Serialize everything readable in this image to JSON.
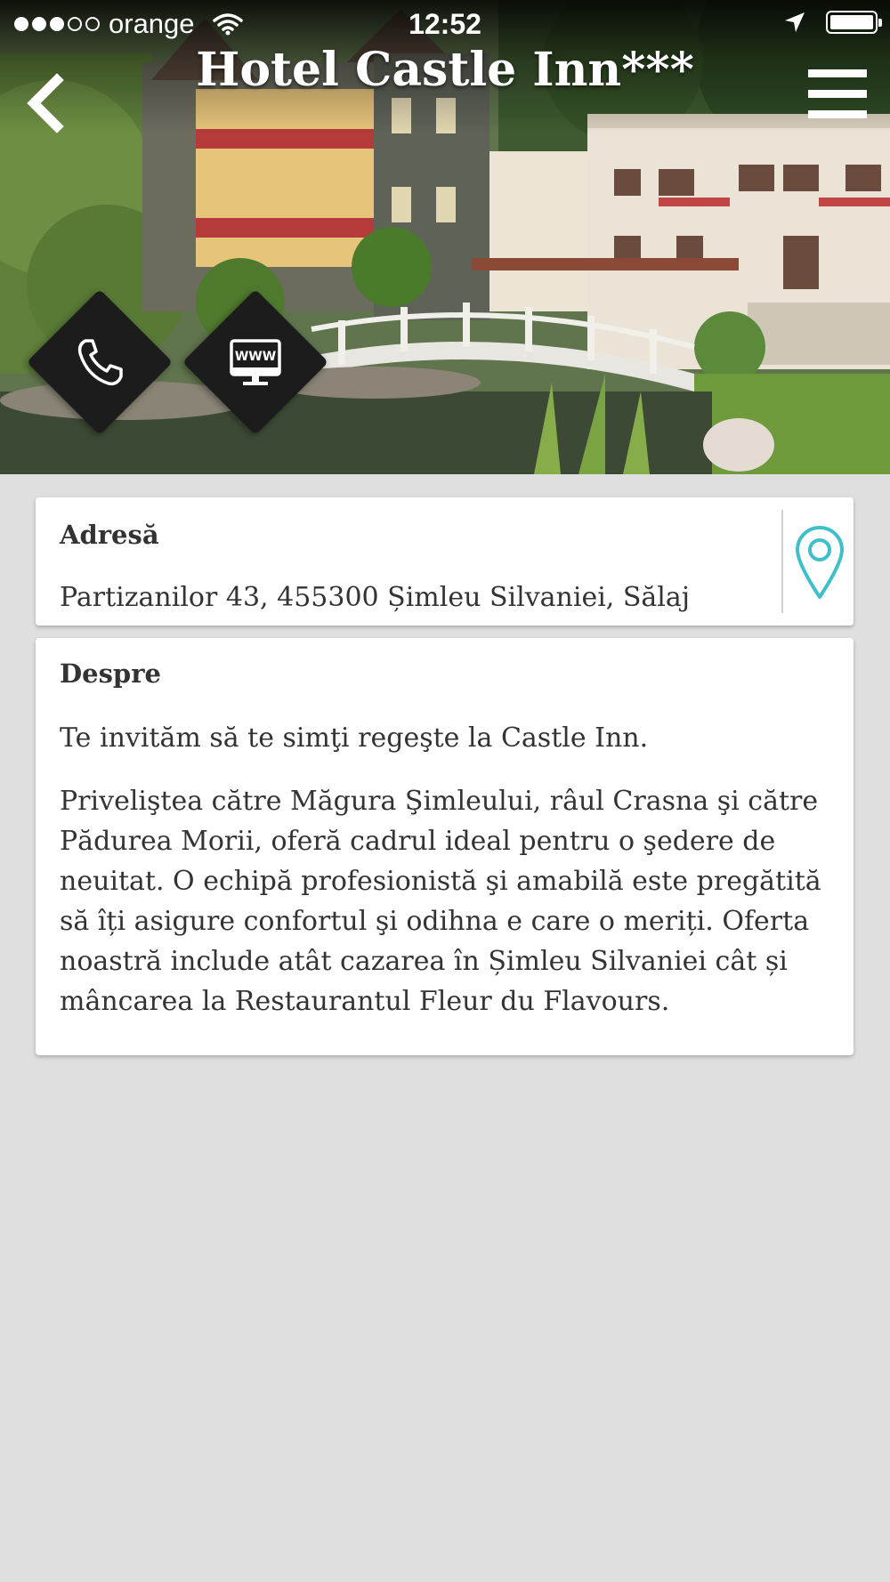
{
  "status_bar": {
    "carrier": "orange",
    "time": "12:52",
    "signal_filled": 3,
    "signal_total": 5,
    "battery_level": 1.0,
    "icons": [
      "wifi-icon",
      "location-arrow-icon",
      "battery-icon"
    ]
  },
  "header": {
    "title": "Hotel Castle Inn***",
    "back_icon": "chevron-left-icon",
    "menu_icon": "hamburger-menu-icon"
  },
  "actions": [
    {
      "name": "phone",
      "icon": "phone-icon"
    },
    {
      "name": "website",
      "icon": "www-monitor-icon"
    }
  ],
  "address_card": {
    "heading": "Adresă",
    "address": "Partizanilor 43, 455300 Șimleu Silvaniei, Sălaj",
    "map_icon": "map-pin-icon",
    "accent_color": "#3fbfc9"
  },
  "about_card": {
    "heading": "Despre",
    "paragraphs": [
      "Te invităm să te simţi regeşte la Castle Inn.",
      "Priveliştea către Măgura Şimleului, râul Crasna şi către Pădurea Morii, oferă cadrul ideal pentru o şedere de neuitat. O echipă profesionistă şi amabilă este pregătită să îți asigure confortul şi odihna e care o meriți. Oferta noastră include atât cazarea în Șimleu Silvaniei cât și mâncarea la Restaurantul Fleur du Flavours."
    ]
  },
  "colors": {
    "background": "#dfdfdf",
    "card": "#ffffff",
    "text": "#333333",
    "action_button": "#1c1c1c"
  }
}
